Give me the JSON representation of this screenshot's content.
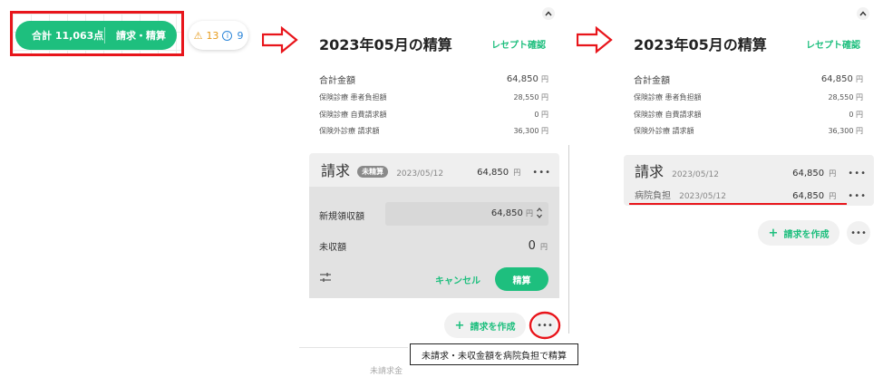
{
  "panel1": {
    "total_label": "合計 11,063点",
    "settle_label": "請求・精算",
    "warning_count": "13",
    "info_count": "9",
    "accent_color": "#1ebf7e",
    "highlight_color": "#e8151b"
  },
  "panel2": {
    "title": "2023年05月の精算",
    "receipt_link": "レセプト確認",
    "total": {
      "label": "合計金額",
      "value": "64,850",
      "unit": "円"
    },
    "lines": [
      {
        "label": "保険診療 患者負担額",
        "value": "28,550",
        "unit": "円"
      },
      {
        "label": "保険診療 自費請求額",
        "value": "0",
        "unit": "円"
      },
      {
        "label": "保険外診療 請求額",
        "value": "36,300",
        "unit": "円"
      }
    ],
    "bill": {
      "heading": "請求",
      "badge": "未精算",
      "date": "2023/05/12",
      "amount": "64,850",
      "unit": "円",
      "more": "•••"
    },
    "form": {
      "new_receipt_label": "新規領収額",
      "new_receipt_value": "64,850",
      "new_receipt_unit": "円",
      "unpaid_label": "未収額",
      "unpaid_value": "0",
      "unpaid_unit": "円",
      "cancel_label": "キャンセル",
      "settle_label": "精算"
    },
    "create_label": "請求を作成",
    "more": "•••",
    "tooltip": "未請求・未収金額を病院負担で精算",
    "cut_text": "未請求金"
  },
  "panel3": {
    "title": "2023年05月の精算",
    "receipt_link": "レセプト確認",
    "total": {
      "label": "合計金額",
      "value": "64,850",
      "unit": "円"
    },
    "lines": [
      {
        "label": "保険診療 患者負担額",
        "value": "28,550",
        "unit": "円"
      },
      {
        "label": "保険診療 自費請求額",
        "value": "0",
        "unit": "円"
      },
      {
        "label": "保険外診療 請求額",
        "value": "36,300",
        "unit": "円"
      }
    ],
    "bill": {
      "heading": "請求",
      "date": "2023/05/12",
      "amount": "64,850",
      "unit": "円",
      "more": "•••"
    },
    "hospital": {
      "label": "病院負担",
      "date": "2023/05/12",
      "amount": "64,850",
      "unit": "円",
      "more": "•••"
    },
    "create_label": "請求を作成",
    "more": "•••"
  }
}
